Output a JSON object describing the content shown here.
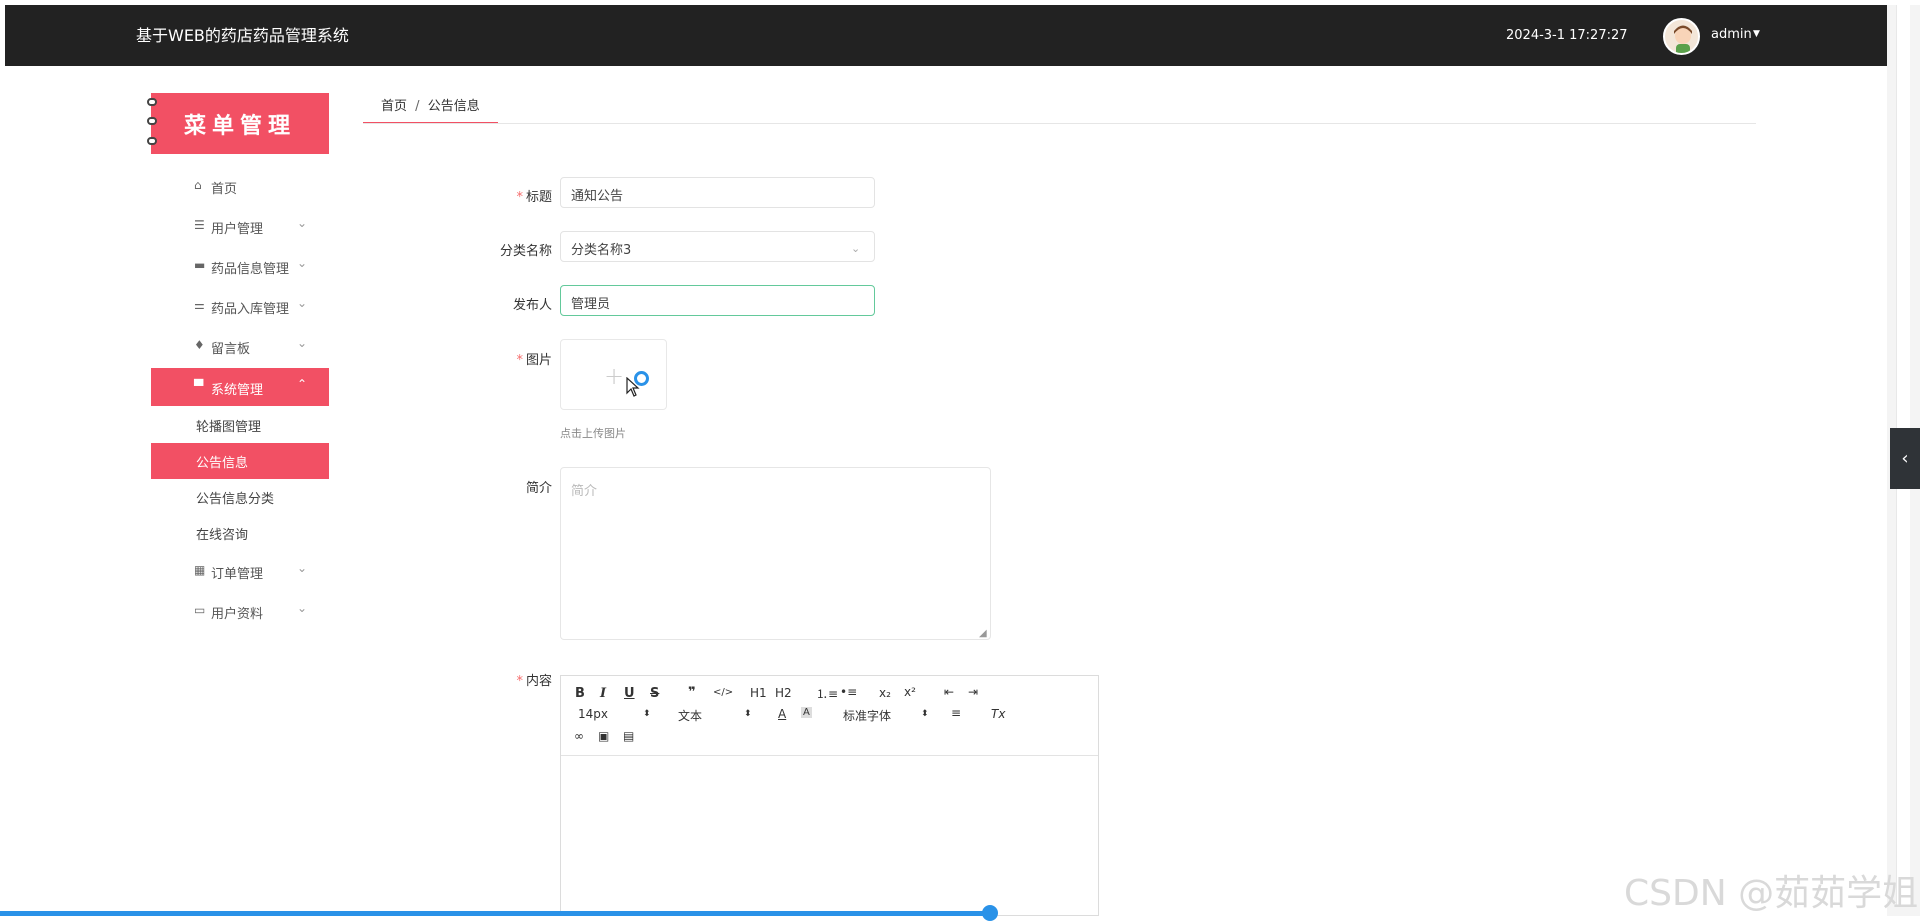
{
  "header": {
    "title": "基于WEB的药店药品管理系统",
    "datetime": "2024-3-1 17:27:27",
    "user": "admin"
  },
  "sidebar": {
    "banner": "菜单管理",
    "items": [
      {
        "label": "首页",
        "icon": "home-icon"
      },
      {
        "label": "用户管理",
        "icon": "list-icon"
      },
      {
        "label": "药品信息管理",
        "icon": "briefcase-icon"
      },
      {
        "label": "药品入库管理",
        "icon": "sliders-icon"
      },
      {
        "label": "留言板",
        "icon": "pin-icon"
      },
      {
        "label": "系统管理",
        "icon": "chat-icon"
      },
      {
        "label": "订单管理",
        "icon": "grid-icon"
      },
      {
        "label": "用户资料",
        "icon": "card-icon"
      }
    ],
    "system_subitems": [
      {
        "label": "轮播图管理"
      },
      {
        "label": "公告信息"
      },
      {
        "label": "公告信息分类"
      },
      {
        "label": "在线咨询"
      }
    ]
  },
  "breadcrumb": {
    "home": "首页",
    "separator": "/",
    "current": "公告信息"
  },
  "form": {
    "title": {
      "label": "标题",
      "value": "通知公告"
    },
    "category": {
      "label": "分类名称",
      "value": "分类名称3"
    },
    "publisher": {
      "label": "发布人",
      "value": "管理员"
    },
    "image": {
      "label": "图片",
      "hint": "点击上传图片"
    },
    "summary": {
      "label": "简介",
      "placeholder": "简介"
    },
    "content": {
      "label": "内容"
    }
  },
  "editor": {
    "bold": "B",
    "italic": "I",
    "underline": "U",
    "strike": "S",
    "quote": "❞",
    "code": "</>",
    "h1": "H1",
    "h2": "H2",
    "subscript": "x₂",
    "superscript": "x²",
    "size": "14px",
    "header_select": "文本",
    "font_select": "标准字体",
    "clear_format": "Tx"
  },
  "watermark": "CSDN @茹茹学姐",
  "colors": {
    "accent": "#f25064",
    "header_bg": "#222222",
    "focus": "#63c99b"
  }
}
